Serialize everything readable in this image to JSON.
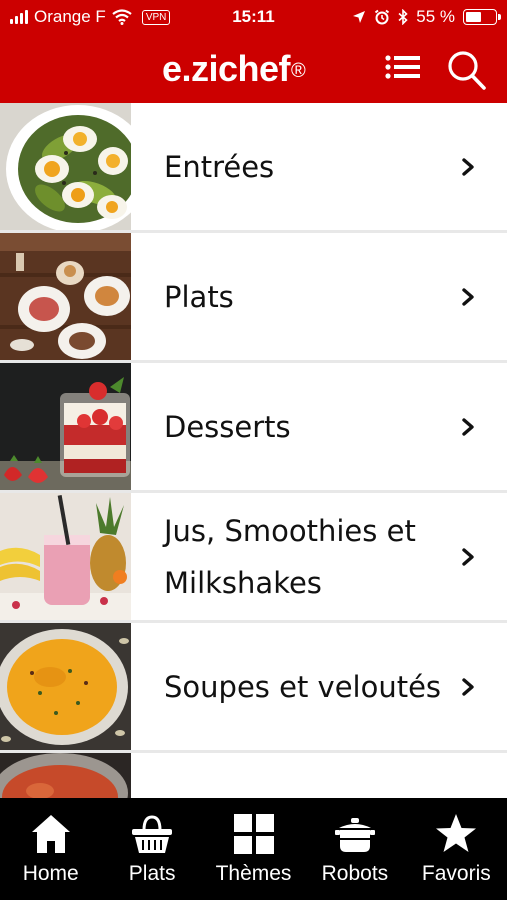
{
  "status_bar": {
    "carrier": "Orange F",
    "vpn": "VPN",
    "time": "15:11",
    "battery": "55 %",
    "battery_level": 0.55
  },
  "header": {
    "logo": "e.zichef",
    "logo_mark": "®",
    "menu_icon": "list-icon",
    "search_icon": "search-icon"
  },
  "categories": [
    {
      "label": "Entrées",
      "image": "salad-eggs-avocado-photo"
    },
    {
      "label": "Plats",
      "image": "table-plates-photo"
    },
    {
      "label": "Desserts",
      "image": "strawberry-trifle-photo"
    },
    {
      "label": "Jus, Smoothies et Milkshakes",
      "image": "pink-smoothie-pineapple-photo"
    },
    {
      "label": "Soupes et veloutés",
      "image": "orange-soup-bowl-photo"
    },
    {
      "label": "",
      "image": "tomato-dish-photo"
    }
  ],
  "tabs": [
    {
      "label": "Home",
      "icon": "home-icon"
    },
    {
      "label": "Plats",
      "icon": "basket-icon"
    },
    {
      "label": "Thèmes",
      "icon": "grid-icon"
    },
    {
      "label": "Robots",
      "icon": "pot-icon"
    },
    {
      "label": "Favoris",
      "icon": "star-icon"
    }
  ],
  "colors": {
    "brand_red": "#cc0000",
    "tab_bar": "#000000",
    "text": "#111111"
  }
}
